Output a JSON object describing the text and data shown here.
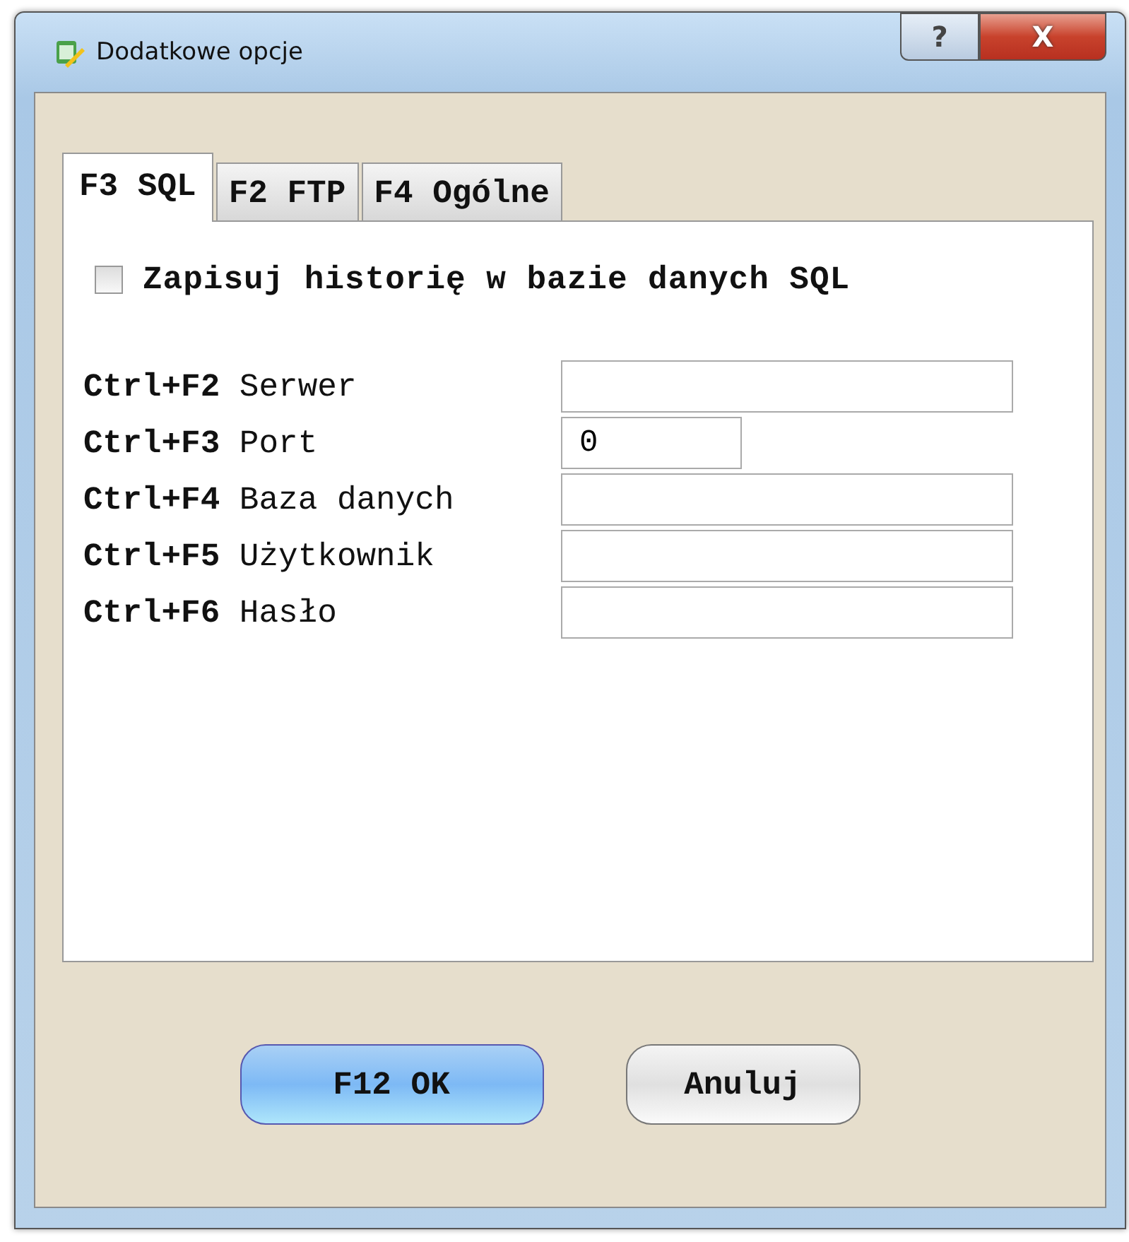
{
  "window": {
    "title": "Dodatkowe opcje",
    "buttons": [
      {
        "kind": "help",
        "label": "?"
      },
      {
        "kind": "close",
        "label": "X"
      }
    ]
  },
  "tabs": [
    {
      "label": "F3 SQL",
      "selected": true
    },
    {
      "label": "F2 FTP",
      "selected": false
    },
    {
      "label": "F4 Ogólne",
      "selected": false
    }
  ],
  "checkbox": {
    "label": "Zapisuj historię w bazie danych SQL",
    "checked": false
  },
  "fields": [
    {
      "label": "**Ctrl+F2** Serwer",
      "kind": "text"
    },
    {
      "label": "**Ctrl+F3** Port",
      "kind": "number",
      "value": "0"
    },
    {
      "label": "**Ctrl+F4** Baza danych",
      "kind": "text"
    },
    {
      "label": "**Ctrl+F5** Użytkownik",
      "kind": "text"
    },
    {
      "label": "**Ctrl+F6** Hasło",
      "kind": "text"
    }
  ],
  "buttons": [
    {
      "label": "F12 OK",
      "kind": "default"
    },
    {
      "label": "Anuluj",
      "kind": "normal"
    }
  ]
}
